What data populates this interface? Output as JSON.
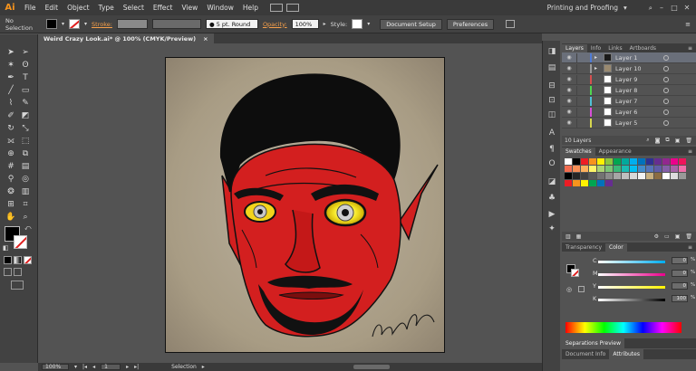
{
  "app": {
    "logo": "Ai",
    "workspace": "Printing and Proofing"
  },
  "menu": [
    "File",
    "Edit",
    "Object",
    "Type",
    "Select",
    "Effect",
    "View",
    "Window",
    "Help"
  ],
  "control_bar": {
    "selection": "No Selection",
    "stroke_label": "Stroke:",
    "brush": "5 pt. Round",
    "opacity_label": "Opacity:",
    "opacity_value": "100%",
    "style_label": "Style:",
    "doc_setup": "Document Setup",
    "preferences": "Preferences"
  },
  "document": {
    "tab_title": "Weird Crazy Look.ai* @ 100% (CMYK/Preview)",
    "close": "×"
  },
  "status": {
    "zoom": "100%",
    "page": "1",
    "tool": "Selection"
  },
  "layers_panel": {
    "tabs": [
      "Layers",
      "Info",
      "Links",
      "Artboards"
    ],
    "layers": [
      {
        "name": "Layer 1",
        "color": "#4f7bd6"
      },
      {
        "name": "Layer 10",
        "color": "#9a9a9a"
      },
      {
        "name": "Layer 9",
        "color": "#d64f4f"
      },
      {
        "name": "Layer 8",
        "color": "#4fd64f"
      },
      {
        "name": "Layer 7",
        "color": "#4fc1d6"
      },
      {
        "name": "Layer 6",
        "color": "#d64fd6"
      },
      {
        "name": "Layer 5",
        "color": "#d6d64f"
      }
    ],
    "count": "10 Layers"
  },
  "swatches_panel": {
    "tabs": [
      "Swatches",
      "Appearance"
    ],
    "colors": [
      "#ffffff",
      "#000000",
      "#ed1c24",
      "#f7941d",
      "#fff200",
      "#8dc63f",
      "#00a651",
      "#00a99d",
      "#00aeef",
      "#0072bc",
      "#2e3192",
      "#662d91",
      "#92278f",
      "#ec008c",
      "#ed145b",
      "#f26c4f",
      "#f68e56",
      "#fbaf5d",
      "#fff568",
      "#acd373",
      "#7cc576",
      "#3bb878",
      "#1abbb4",
      "#00bff3",
      "#438ccb",
      "#5574b9",
      "#605ca8",
      "#855fa8",
      "#a763a8",
      "#f06eaa",
      "#000000",
      "#262626",
      "#404040",
      "#595959",
      "#737373",
      "#8c8c8c",
      "#a6a6a6",
      "#bfbfbf",
      "#d9d9d9",
      "#f2f2f2",
      "#c8b080",
      "#8b6c42",
      "#ffffff",
      "#dddddd",
      "#999999",
      "#ed1c24",
      "#f7941d",
      "#fff200",
      "#00a651",
      "#0072bc",
      "#662d91"
    ]
  },
  "color_panel": {
    "tabs": [
      "Transparency",
      "Color"
    ],
    "channels": [
      {
        "label": "C",
        "value": "0"
      },
      {
        "label": "M",
        "value": "0"
      },
      {
        "label": "Y",
        "value": "0"
      },
      {
        "label": "K",
        "value": "100"
      }
    ],
    "unit": "%"
  },
  "bottom_panels": {
    "separations": "Separations Preview",
    "doc_info": "Document Info",
    "attributes": "Attributes"
  }
}
